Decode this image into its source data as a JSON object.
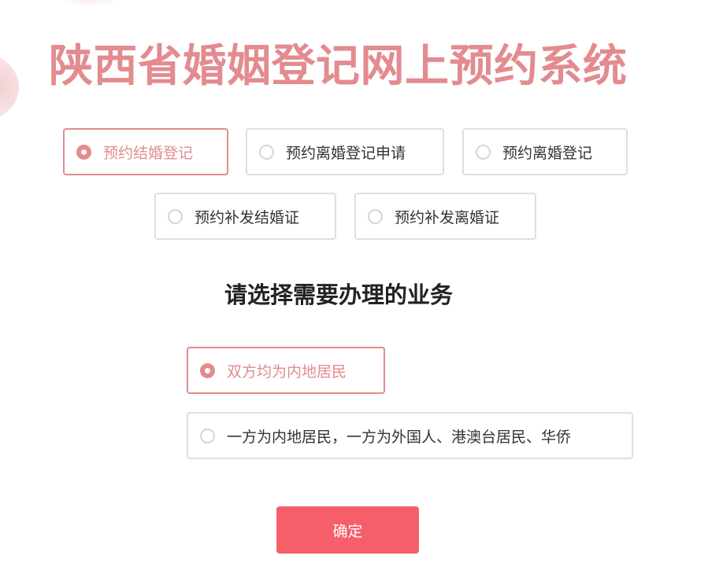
{
  "title": "陕西省婚姻登记网上预约系统",
  "service_options": [
    {
      "label": "预约结婚登记",
      "selected": true
    },
    {
      "label": "预约离婚登记申请",
      "selected": false
    },
    {
      "label": "预约离婚登记",
      "selected": false
    },
    {
      "label": "预约补发结婚证",
      "selected": false
    },
    {
      "label": "预约补发离婚证",
      "selected": false
    }
  ],
  "subtitle": "请选择需要办理的业务",
  "residency_options": [
    {
      "label": "双方均为内地居民",
      "selected": true
    },
    {
      "label": "一方为内地居民，一方为外国人、港澳台居民、华侨",
      "selected": false
    }
  ],
  "confirm_label": "确定",
  "colors": {
    "accent": "#e38b8f",
    "button": "#f55f69",
    "border": "#dcdfe3",
    "text": "#333333"
  }
}
